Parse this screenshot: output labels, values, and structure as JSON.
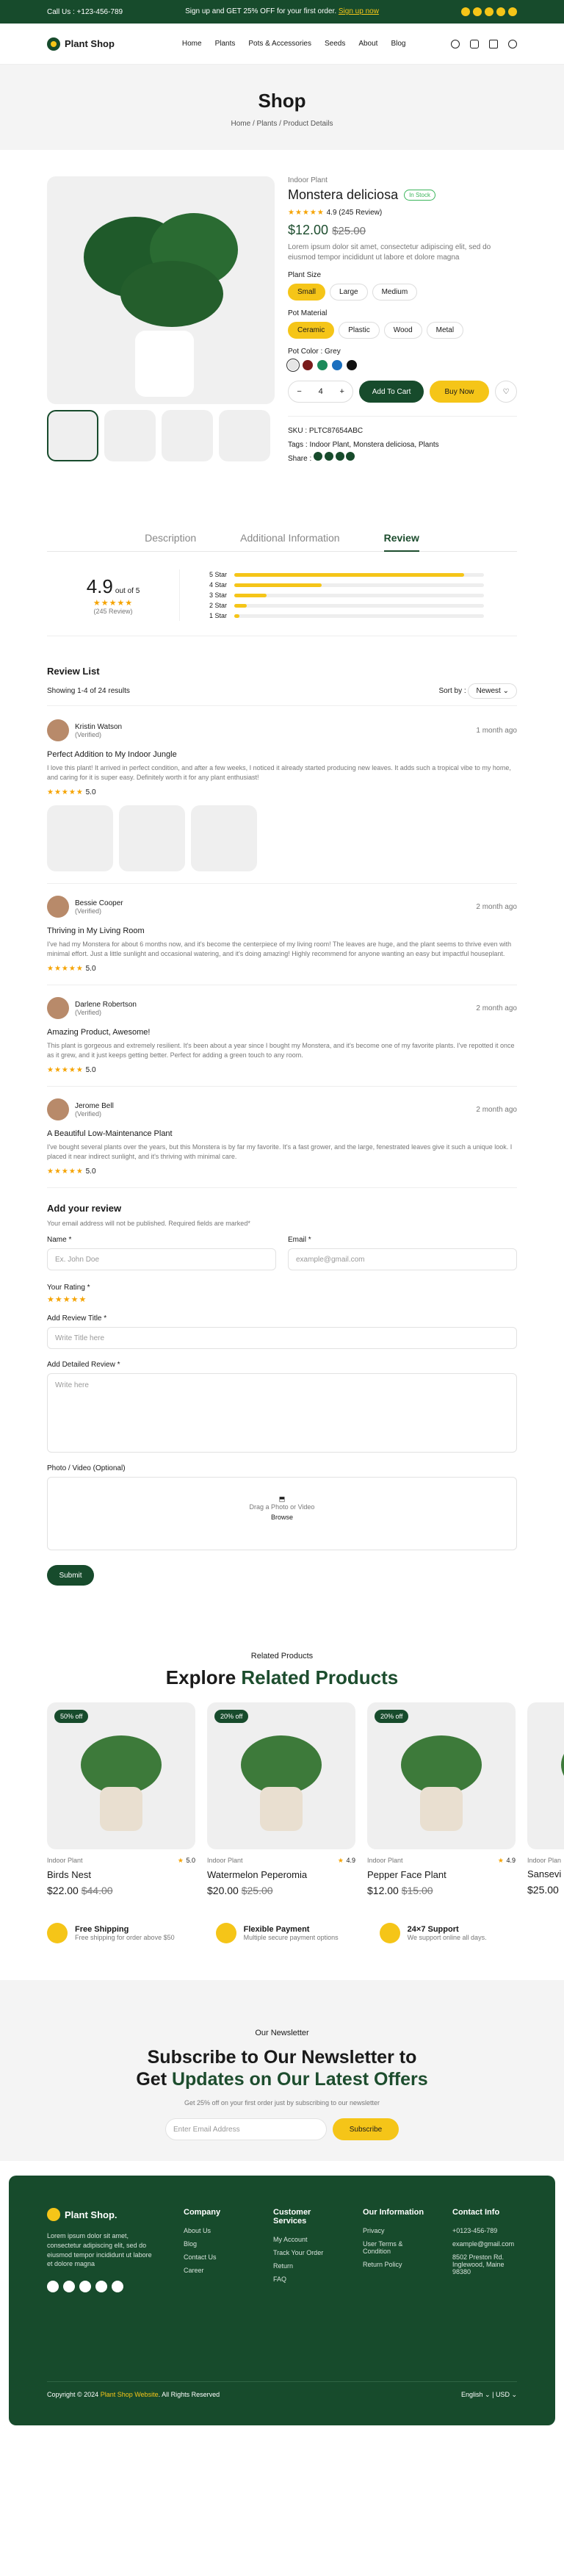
{
  "topbar": {
    "phone": "Call Us : +123-456-789",
    "promo": "Sign up and GET 25% OFF for your first order.",
    "promo_link": "Sign up now"
  },
  "nav": {
    "brand": "Plant Shop",
    "menu": [
      "Home",
      "Plants",
      "Pots & Accessories",
      "Seeds",
      "About",
      "Blog"
    ]
  },
  "hero": {
    "title": "Shop",
    "breadcrumb": [
      "Home",
      "Plants",
      "Product Details"
    ]
  },
  "product": {
    "category": "Indoor Plant",
    "name": "Monstera deliciosa",
    "badge": "In Stock",
    "rating": "4.9",
    "reviews": "(245 Review)",
    "price": "$12.00",
    "old_price": "$25.00",
    "desc": "Lorem ipsum dolor sit amet, consectetur adipiscing elit, sed do eiusmod tempor incididunt ut labore et dolore magna",
    "size_label": "Plant Size",
    "sizes": [
      "Small",
      "Large",
      "Medium"
    ],
    "material_label": "Pot Material",
    "materials": [
      "Ceramic",
      "Plastic",
      "Wood",
      "Metal"
    ],
    "color_label": "Pot Color : Grey",
    "colors": [
      "#e6e6e6",
      "#7a1b1b",
      "#1b8a5a",
      "#1a6fbf",
      "#111111"
    ],
    "qty": "4",
    "add_to_cart": "Add To Cart",
    "buy_now": "Buy Now",
    "sku": "SKU : PLTC87654ABC",
    "tags": "Tags : Indoor Plant, Monstera deliciosa, Plants",
    "share": "Share :"
  },
  "tabs": [
    "Description",
    "Additional Information",
    "Review"
  ],
  "summary": {
    "avg": "4.9",
    "outof": "out of 5",
    "count": "(245 Review)",
    "rows": [
      {
        "label": "5 Star",
        "pct": 0.92
      },
      {
        "label": "4 Star",
        "pct": 0.35
      },
      {
        "label": "3 Star",
        "pct": 0.13
      },
      {
        "label": "2 Star",
        "pct": 0.05
      },
      {
        "label": "1 Star",
        "pct": 0.02
      }
    ]
  },
  "reviewlist": {
    "title": "Review List",
    "showing": "Showing 1-4 of 24 results",
    "sortby": "Sort by :",
    "sort": "Newest"
  },
  "reviews": [
    {
      "name": "Kristin Watson",
      "verified": "(Verified)",
      "time": "1 month ago",
      "title": "Perfect Addition to My Indoor Jungle",
      "body": "I love this plant! It arrived in perfect condition, and after a few weeks, I noticed it already started producing new leaves. It adds such a tropical vibe to my home, and caring for it is super easy. Definitely worth it for any plant enthusiast!",
      "score": "5.0"
    },
    {
      "name": "Bessie Cooper",
      "verified": "(Verified)",
      "time": "2 month ago",
      "title": "Thriving in My Living Room",
      "body": "I've had my Monstera for about 6 months now, and it's become the centerpiece of my living room! The leaves are huge, and the plant seems to thrive even with minimal effort. Just a little sunlight and occasional watering, and it's doing amazing! Highly recommend for anyone wanting an easy but impactful houseplant.",
      "score": "5.0"
    },
    {
      "name": "Darlene Robertson",
      "verified": "(Verified)",
      "time": "2 month ago",
      "title": "Amazing Product, Awesome!",
      "body": "This plant is gorgeous and extremely resilient. It's been about a year since I bought my Monstera, and it's become one of my favorite plants. I've repotted it once as it grew, and it just keeps getting better. Perfect for adding a green touch to any room.",
      "score": "5.0"
    },
    {
      "name": "Jerome Bell",
      "verified": "(Verified)",
      "time": "2 month ago",
      "title": "A Beautiful Low-Maintenance Plant",
      "body": "I've bought several plants over the years, but this Monstera is by far my favorite. It's a fast grower, and the large, fenestrated leaves give it such a unique look. I placed it near indirect sunlight, and it's thriving with minimal care.",
      "score": "5.0"
    }
  ],
  "form": {
    "title": "Add your review",
    "note": "Your email address will not be published. Required fields are marked*",
    "name_label": "Name *",
    "name_ph": "Ex. John Doe",
    "email_label": "Email *",
    "email_ph": "example@gmail.com",
    "rating_label": "Your Rating *",
    "rtitle_label": "Add Review Title *",
    "rtitle_ph": "Write Title here",
    "detail_label": "Add Detailed Review *",
    "detail_ph": "Write here",
    "photo_label": "Photo / Video (Optional)",
    "drag": "Drag a Photo or Video",
    "browse": "Browse",
    "submit": "Submit"
  },
  "related": {
    "eyebrow": "Related Products",
    "title_a": "Explore ",
    "title_b": "Related Products",
    "items": [
      {
        "off": "50% off",
        "cat": "Indoor Plant",
        "rating": "5.0",
        "name": "Birds Nest",
        "price": "$22.00",
        "old": "$44.00"
      },
      {
        "off": "20% off",
        "cat": "Indoor Plant",
        "rating": "4.9",
        "name": "Watermelon Peperomia",
        "price": "$20.00",
        "old": "$25.00"
      },
      {
        "off": "20% off",
        "cat": "Indoor Plant",
        "rating": "4.9",
        "name": "Pepper Face Plant",
        "price": "$12.00",
        "old": "$15.00"
      },
      {
        "off": "",
        "cat": "Indoor Plan",
        "rating": "",
        "name": "Sansevi",
        "price": "$25.00",
        "old": ""
      }
    ]
  },
  "features": [
    {
      "t": "Free Shipping",
      "s": "Free shipping for order above $50"
    },
    {
      "t": "Flexible Payment",
      "s": "Multiple secure payment options"
    },
    {
      "t": "24×7 Support",
      "s": "We support online all days."
    }
  ],
  "newsletter": {
    "eyebrow": "Our Newsletter",
    "l1": "Subscribe to Our Newsletter to",
    "l2a": "Get ",
    "l2b": "Updates on Our Latest Offers",
    "sub": "Get 25% off on your first order just by subscribing to our newsletter",
    "ph": "Enter Email Address",
    "btn": "Subscribe"
  },
  "footer": {
    "brand": "Plant Shop.",
    "about": "Lorem ipsum dolor sit amet, consectetur adipiscing elit, sed do eiusmod tempor incididunt ut labore et dolore magna",
    "cols": [
      {
        "h": "Company",
        "items": [
          "About Us",
          "Blog",
          "Contact Us",
          "Career"
        ]
      },
      {
        "h": "Customer Services",
        "items": [
          "My Account",
          "Track Your Order",
          "Return",
          "FAQ"
        ]
      },
      {
        "h": "Our Information",
        "items": [
          "Privacy",
          "User Terms & Condition",
          "Return Policy"
        ]
      },
      {
        "h": "Contact Info",
        "items": [
          "+0123-456-789",
          "example@gmail.com",
          "8502 Preston Rd. Inglewood, Maine 98380"
        ]
      }
    ],
    "copy_a": "Copyright © 2024 ",
    "copy_b": "Plant Shop Website",
    "copy_c": ". All Rights Reserved",
    "lang": "English",
    "cur": "USD"
  }
}
